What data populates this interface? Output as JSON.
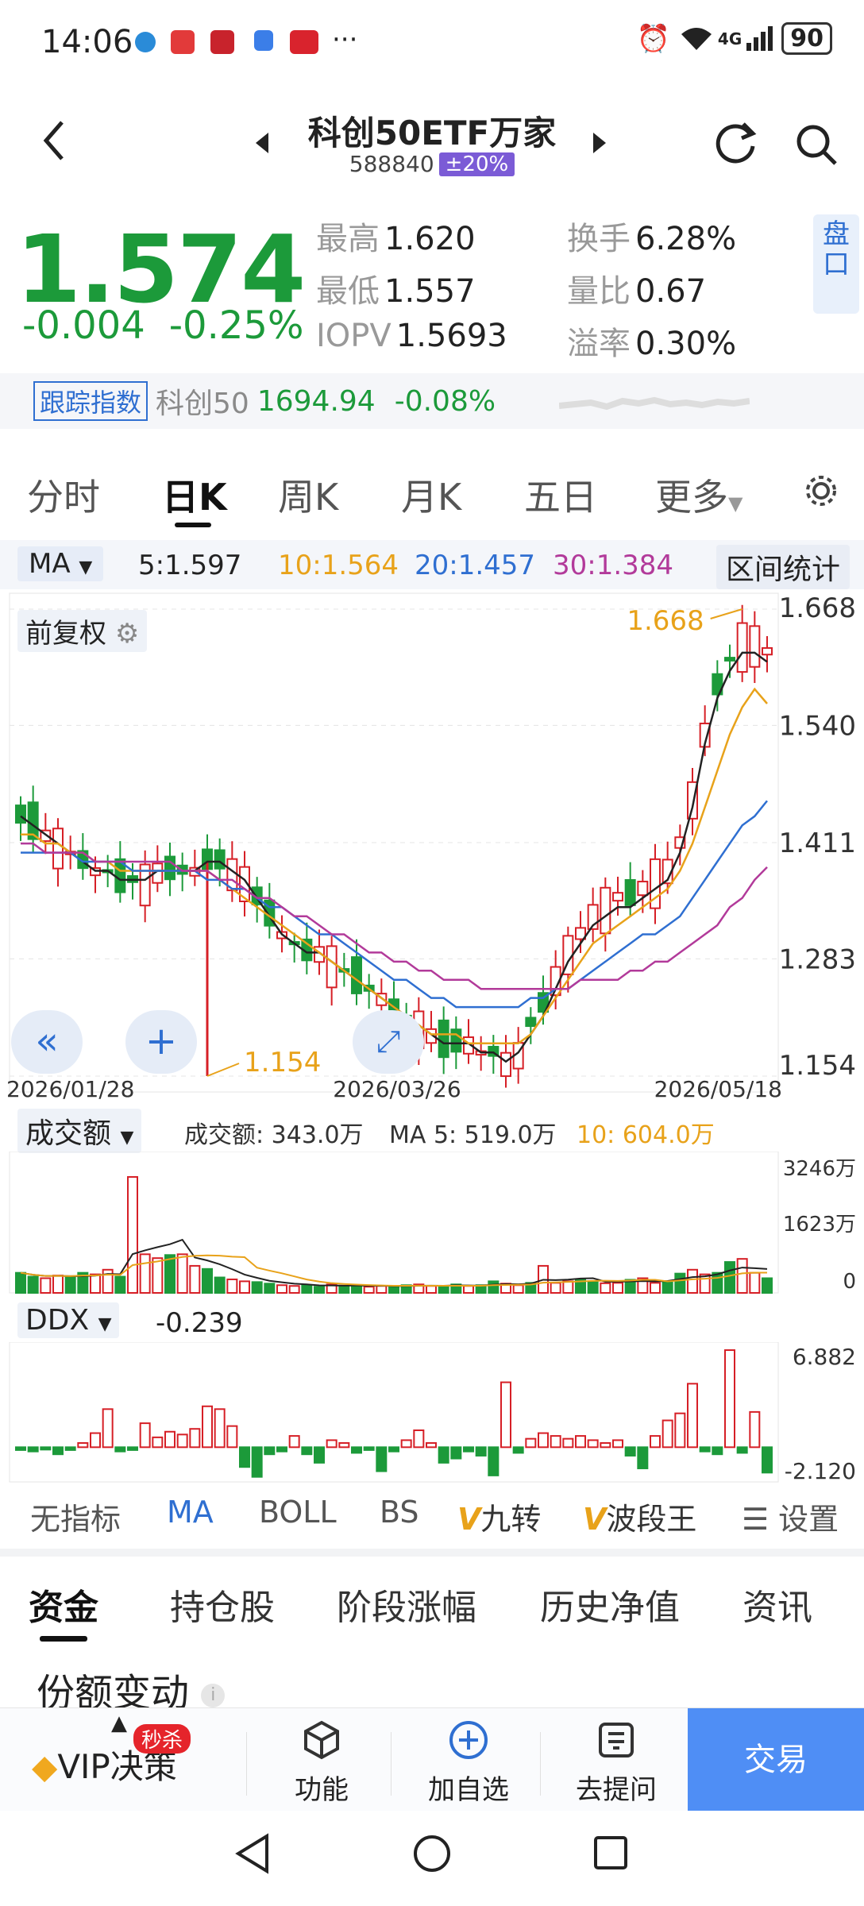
{
  "status": {
    "time": "14:06",
    "signal": "4G",
    "battery": "90"
  },
  "header": {
    "title": "科创50ETF万家",
    "code": "588840",
    "limit_badge": "±20%"
  },
  "quote": {
    "price": "1.574",
    "change": "-0.004",
    "change_pct": "-0.25%",
    "high_label": "最高",
    "high": "1.620",
    "low_label": "最低",
    "low": "1.557",
    "iopv_label": "IOPV",
    "iopv": "1.5693",
    "turnover_label": "换手",
    "turnover": "6.28%",
    "vol_ratio_label": "量比",
    "vol_ratio": "0.67",
    "premium_label": "溢率",
    "premium": "0.30%",
    "pankou": "盘口"
  },
  "index": {
    "tag": "跟踪指数",
    "name": "科创50",
    "value": "1694.94",
    "change": "-0.08%"
  },
  "kline_tabs": [
    "分时",
    "日K",
    "周K",
    "月K",
    "五日",
    "更多"
  ],
  "ma": {
    "selector": "MA",
    "ma5": "5:1.597",
    "ma10": "10:1.564",
    "ma20": "20:1.457",
    "ma30": "30:1.384",
    "range_stats": "区间统计",
    "adjust": "前复权"
  },
  "colors": {
    "up": "#d61f26",
    "down": "#1c9a3a",
    "ma5": "#222222",
    "ma10": "#e8a21a",
    "ma20": "#2f6fd1",
    "ma30": "#b23a9a"
  },
  "chart_data": [
    {
      "type": "candlestick",
      "title": "",
      "y_ticks": [
        "1.668",
        "1.540",
        "1.411",
        "1.283",
        "1.154"
      ],
      "ylim": [
        1.154,
        1.668
      ],
      "x_ticks": [
        "2026/01/28",
        "2026/03/26",
        "2026/05/18"
      ],
      "annotations": [
        {
          "label": "1.668",
          "type": "max"
        },
        {
          "label": "1.154",
          "type": "min"
        }
      ],
      "series": [
        {
          "name": "MA5",
          "values": [
            1.44,
            1.43,
            1.42,
            1.41,
            1.4,
            1.39,
            1.38,
            1.38,
            1.37,
            1.37,
            1.37,
            1.38,
            1.38,
            1.38,
            1.38,
            1.39,
            1.39,
            1.38,
            1.37,
            1.35,
            1.33,
            1.31,
            1.3,
            1.29,
            1.29,
            1.28,
            1.27,
            1.26,
            1.25,
            1.24,
            1.23,
            1.22,
            1.21,
            1.2,
            1.19,
            1.19,
            1.19,
            1.18,
            1.18,
            1.17,
            1.18,
            1.2,
            1.22,
            1.25,
            1.28,
            1.3,
            1.32,
            1.33,
            1.34,
            1.34,
            1.35,
            1.36,
            1.37,
            1.4,
            1.45,
            1.52,
            1.57,
            1.6,
            1.62,
            1.62,
            1.61
          ]
        },
        {
          "name": "MA10",
          "values": [
            1.42,
            1.42,
            1.41,
            1.41,
            1.4,
            1.4,
            1.39,
            1.39,
            1.38,
            1.38,
            1.38,
            1.38,
            1.38,
            1.38,
            1.38,
            1.38,
            1.37,
            1.36,
            1.35,
            1.34,
            1.33,
            1.32,
            1.31,
            1.3,
            1.29,
            1.28,
            1.27,
            1.26,
            1.25,
            1.24,
            1.23,
            1.22,
            1.21,
            1.2,
            1.2,
            1.2,
            1.19,
            1.19,
            1.19,
            1.19,
            1.19,
            1.2,
            1.22,
            1.24,
            1.26,
            1.28,
            1.3,
            1.31,
            1.32,
            1.33,
            1.34,
            1.35,
            1.36,
            1.38,
            1.41,
            1.45,
            1.49,
            1.53,
            1.56,
            1.58,
            1.564
          ]
        },
        {
          "name": "MA20",
          "values": [
            1.4,
            1.4,
            1.4,
            1.4,
            1.4,
            1.39,
            1.39,
            1.39,
            1.39,
            1.38,
            1.38,
            1.38,
            1.38,
            1.38,
            1.38,
            1.37,
            1.37,
            1.36,
            1.36,
            1.35,
            1.34,
            1.34,
            1.33,
            1.32,
            1.31,
            1.31,
            1.3,
            1.29,
            1.28,
            1.27,
            1.26,
            1.26,
            1.25,
            1.24,
            1.24,
            1.23,
            1.23,
            1.23,
            1.23,
            1.23,
            1.23,
            1.24,
            1.24,
            1.25,
            1.25,
            1.26,
            1.27,
            1.28,
            1.29,
            1.3,
            1.31,
            1.31,
            1.32,
            1.33,
            1.35,
            1.37,
            1.39,
            1.41,
            1.43,
            1.44,
            1.457
          ]
        },
        {
          "name": "MA30",
          "values": [
            1.41,
            1.41,
            1.4,
            1.4,
            1.4,
            1.4,
            1.39,
            1.39,
            1.39,
            1.39,
            1.39,
            1.39,
            1.39,
            1.38,
            1.38,
            1.38,
            1.37,
            1.37,
            1.36,
            1.35,
            1.35,
            1.34,
            1.33,
            1.33,
            1.32,
            1.31,
            1.31,
            1.3,
            1.29,
            1.29,
            1.28,
            1.28,
            1.27,
            1.27,
            1.26,
            1.26,
            1.26,
            1.25,
            1.25,
            1.25,
            1.25,
            1.25,
            1.25,
            1.25,
            1.25,
            1.26,
            1.26,
            1.26,
            1.26,
            1.27,
            1.27,
            1.28,
            1.28,
            1.29,
            1.3,
            1.31,
            1.32,
            1.34,
            1.35,
            1.37,
            1.384
          ]
        }
      ]
    },
    {
      "type": "bar",
      "title": "成交额",
      "values_text": {
        "volume": "成交额: 343.0万",
        "ma5": "MA 5: 519.0万",
        "ma10": "10: 604.0万"
      },
      "y_ticks": [
        "3246万",
        "1623万",
        "0"
      ],
      "ylim": [
        0,
        3246
      ],
      "values": [
        520,
        420,
        380,
        450,
        400,
        520,
        480,
        600,
        420,
        3000,
        1000,
        900,
        980,
        1000,
        700,
        620,
        400,
        350,
        300,
        280,
        240,
        200,
        180,
        200,
        160,
        220,
        180,
        200,
        160,
        180,
        160,
        200,
        220,
        180,
        160,
        220,
        180,
        200,
        300,
        240,
        200,
        260,
        700,
        260,
        300,
        340,
        300,
        250,
        260,
        340,
        380,
        260,
        300,
        500,
        600,
        480,
        520,
        800,
        880,
        520,
        380
      ]
    },
    {
      "type": "bar",
      "title": "DDX",
      "value": "-0.239",
      "y_ticks": [
        "6.882",
        "-2.120"
      ],
      "ylim": [
        -2.12,
        6.882
      ],
      "values": [
        -0.2,
        -0.3,
        -0.1,
        -0.5,
        -0.2,
        0.3,
        1.0,
        2.7,
        -0.3,
        -0.2,
        1.7,
        0.7,
        1.1,
        0.9,
        1.3,
        2.9,
        2.7,
        1.5,
        -1.4,
        -2.1,
        -0.5,
        -0.3,
        0.8,
        -0.5,
        -1.1,
        0.5,
        0.3,
        -0.4,
        -0.2,
        -1.7,
        -0.3,
        0.5,
        1.2,
        0.3,
        -1.1,
        -0.8,
        -0.3,
        -0.6,
        -2.0,
        4.6,
        -0.4,
        0.6,
        1.0,
        0.8,
        0.6,
        0.8,
        0.5,
        0.3,
        0.5,
        -0.6,
        -1.5,
        0.8,
        1.9,
        2.4,
        4.5,
        -0.3,
        -0.5,
        6.88,
        -0.4,
        2.5,
        -1.8
      ]
    }
  ],
  "indicator_tabs": {
    "none": "无指标",
    "ma": "MA",
    "boll": "BOLL",
    "bs": "BS",
    "jiuzhuan": "九转",
    "boduan": "波段王",
    "settings": "设置"
  },
  "section_tabs": [
    "资金",
    "持仓股",
    "阶段涨幅",
    "历史净值",
    "资讯"
  ],
  "section_title": "份额变动",
  "bottom_nav": {
    "vip": "VIP决策",
    "vip_badge": "秒杀",
    "func": "功能",
    "add": "加自选",
    "ask": "去提问",
    "trade": "交易"
  }
}
